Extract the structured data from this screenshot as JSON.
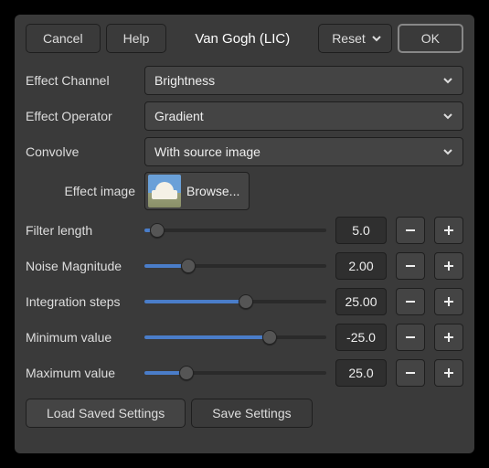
{
  "toolbar": {
    "cancel": "Cancel",
    "help": "Help",
    "title": "Van Gogh (LIC)",
    "reset": "Reset",
    "ok": "OK"
  },
  "fields": {
    "effect_channel": {
      "label": "Effect Channel",
      "value": "Brightness"
    },
    "effect_operator": {
      "label": "Effect Operator",
      "value": "Gradient"
    },
    "convolve": {
      "label": "Convolve",
      "value": "With source image"
    },
    "effect_image": {
      "label": "Effect image",
      "browse": "Browse..."
    }
  },
  "sliders": {
    "filter_length": {
      "label": "Filter length",
      "value": "5.0",
      "pct": 7
    },
    "noise_magnitude": {
      "label": "Noise Magnitude",
      "value": "2.00",
      "pct": 24
    },
    "integration_steps": {
      "label": "Integration steps",
      "value": "25.00",
      "pct": 56
    },
    "minimum_value": {
      "label": "Minimum value",
      "value": "-25.0",
      "pct": 69
    },
    "maximum_value": {
      "label": "Maximum value",
      "value": "25.0",
      "pct": 23
    }
  },
  "footer": {
    "load": "Load Saved Settings",
    "save": "Save Settings"
  }
}
